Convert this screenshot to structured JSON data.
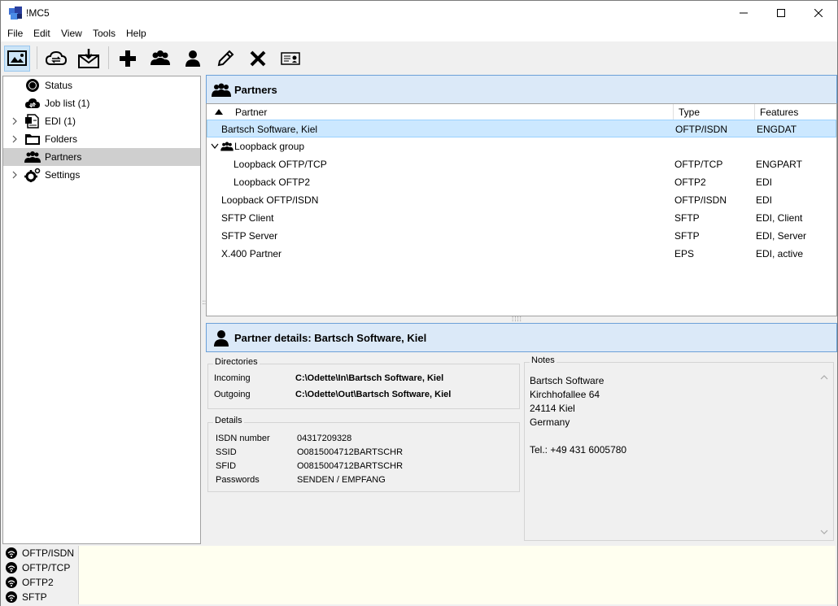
{
  "window": {
    "title": "!MC5"
  },
  "menu": [
    "File",
    "Edit",
    "View",
    "Tools",
    "Help"
  ],
  "toolbar": {
    "buttons": [
      "dashboard-icon",
      "cloud-sync-icon",
      "mail-receive-icon",
      "add-icon",
      "group-icon",
      "partner-icon",
      "edit-icon",
      "delete-icon",
      "certificate-icon"
    ]
  },
  "tree": {
    "items": [
      {
        "label": "Status",
        "icon": "status-icon"
      },
      {
        "label": "Job list (1)",
        "icon": "cloud-icon"
      },
      {
        "label": "EDI (1)",
        "icon": "document-icon"
      },
      {
        "label": "Folders",
        "icon": "folder-icon"
      },
      {
        "label": "Partners",
        "icon": "partners-icon",
        "selected": true
      },
      {
        "label": "Settings",
        "icon": "settings-icon"
      }
    ]
  },
  "partners": {
    "header": "Partners",
    "columns": {
      "partner": "Partner",
      "type": "Type",
      "features": "Features"
    },
    "rows": [
      {
        "partner": "Bartsch Software, Kiel",
        "type": "OFTP/ISDN",
        "features": "ENGDAT"
      },
      {
        "partner": "Loopback group",
        "type": "",
        "features": ""
      },
      {
        "partner": "Loopback OFTP/TCP",
        "type": "OFTP/TCP",
        "features": "ENGPART"
      },
      {
        "partner": "Loopback OFTP2",
        "type": "OFTP2",
        "features": "EDI"
      },
      {
        "partner": "Loopback OFTP/ISDN",
        "type": "OFTP/ISDN",
        "features": "EDI"
      },
      {
        "partner": "SFTP Client",
        "type": "SFTP",
        "features": "EDI, Client"
      },
      {
        "partner": "SFTP Server",
        "type": "SFTP",
        "features": "EDI, Server"
      },
      {
        "partner": "X.400 Partner",
        "type": "EPS",
        "features": "EDI, active"
      }
    ]
  },
  "details": {
    "header": "Partner details: Bartsch Software, Kiel",
    "directories": {
      "title": "Directories",
      "incoming_label": "Incoming",
      "incoming": "C:\\Odette\\In\\Bartsch Software, Kiel",
      "outgoing_label": "Outgoing",
      "outgoing": "C:\\Odette\\Out\\Bartsch Software, Kiel"
    },
    "info": {
      "title": "Details",
      "isdn_label": "ISDN number",
      "isdn": "04317209328",
      "ssid_label": "SSID",
      "ssid": "O0815004712BARTSCHR",
      "sfid_label": "SFID",
      "sfid": "O0815004712BARTSCHR",
      "passwords_label": "Passwords",
      "passwords": "SENDEN / EMPFANG"
    },
    "notes": {
      "title": "Notes",
      "text": "Bartsch Software\nKirchhofallee 64\n24114 Kiel\nGermany\n\nTel.: +49 431 6005780"
    }
  },
  "status": {
    "connections": [
      "OFTP/ISDN",
      "OFTP/TCP",
      "OFTP2",
      "SFTP"
    ]
  }
}
